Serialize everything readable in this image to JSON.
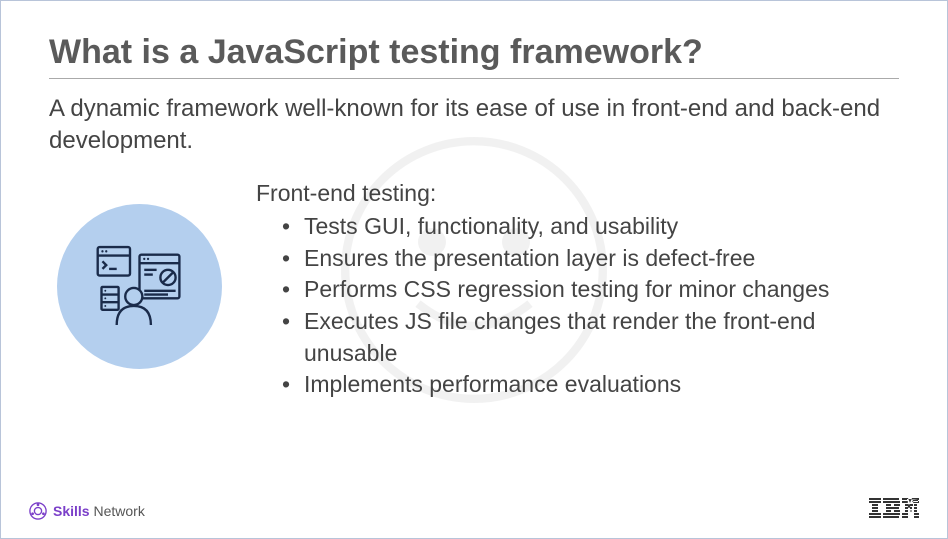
{
  "title": "What is a JavaScript testing framework?",
  "subtitle": "A dynamic framework well-known for its ease of use in front-end and back-end development.",
  "list_title": "Front-end testing:",
  "bullets": [
    "Tests GUI, functionality, and usability",
    "Ensures the presentation layer is defect-free",
    "Performs CSS regression testing for minor changes",
    "Executes JS file changes that render the front-end unusable",
    "Implements performance evaluations"
  ],
  "footer": {
    "skills": "Skills",
    "network": "Network",
    "brand": "IBM"
  }
}
